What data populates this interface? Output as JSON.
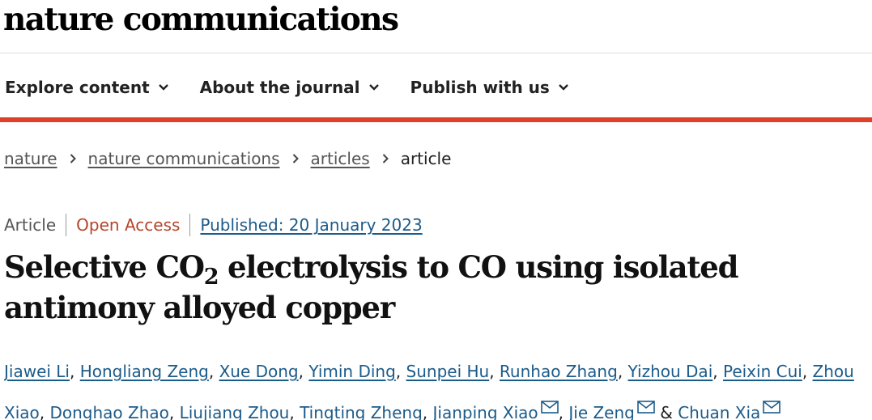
{
  "header": {
    "logo": "nature communications"
  },
  "nav": {
    "items": [
      {
        "label": "Explore content",
        "icon": "chevron-down-icon"
      },
      {
        "label": "About the journal",
        "icon": "chevron-down-icon"
      },
      {
        "label": "Publish with us",
        "icon": "chevron-down-icon"
      }
    ]
  },
  "breadcrumb": {
    "items": [
      {
        "label": "nature"
      },
      {
        "label": "nature communications"
      },
      {
        "label": "articles"
      }
    ],
    "current": "article",
    "separator_icon": "chevron-right-icon"
  },
  "article": {
    "type": "Article",
    "access": "Open Access",
    "published": "Published: 20 January 2023",
    "title_part1": "Selective CO",
    "title_sub": "2",
    "title_part2": " electrolysis to CO using isolated antimony alloyed copper",
    "authors": [
      "Jiawei Li",
      "Hongliang Zeng",
      "Xue Dong",
      "Yimin Ding",
      "Sunpei Hu",
      "Runhao Zhang",
      "Yizhou Dai",
      "Peixin Cui",
      "Zhou",
      "Xiao",
      "Donghao Zhao",
      "Liujiang Zhou",
      "Tingting Zheng",
      "Jianping Xiao",
      "Jie Zeng",
      "Chuan Xia"
    ],
    "contact_icon": "mail-icon",
    "author_separator": ",",
    "last_author_separator": "&"
  },
  "colors": {
    "accent_bar": "#e0402a",
    "open_access": "#b5452a",
    "link": "#1b5b8a",
    "breadcrumb_link": "#555555"
  }
}
